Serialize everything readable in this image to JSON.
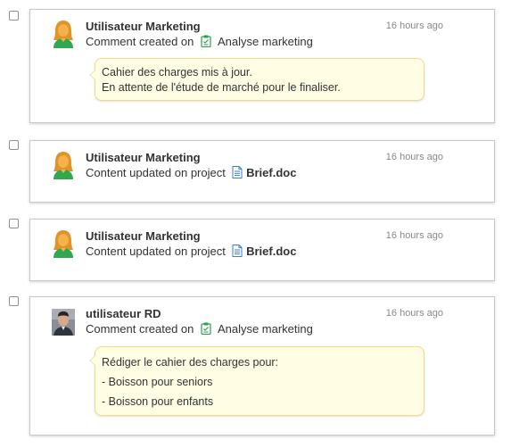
{
  "feed": {
    "items": [
      {
        "author": "Utilisateur Marketing",
        "time": "16 hours ago",
        "action": "Comment created on",
        "target": "Analyse marketing",
        "avatar": "female-user-avatar",
        "target_icon": "clipboard-icon",
        "comment_lines": [
          "Cahier des charges mis à jour.",
          "En attente de l'étude de marché pour le finaliser."
        ]
      },
      {
        "author": "Utilisateur Marketing",
        "time": "16 hours ago",
        "action": "Content updated on project",
        "target": "Brief.doc",
        "avatar": "female-user-avatar",
        "target_icon": "document-icon"
      },
      {
        "author": "Utilisateur Marketing",
        "time": "16 hours ago",
        "action": "Content updated on project",
        "target": "Brief.doc",
        "avatar": "female-user-avatar",
        "target_icon": "document-icon"
      },
      {
        "author": "utilisateur RD",
        "time": "16 hours ago",
        "action": "Comment created on",
        "target": "Analyse marketing",
        "avatar": "male-user-photo",
        "target_icon": "clipboard-icon",
        "comment_lines": [
          "Rédiger le cahier des charges pour:",
          "- Boisson pour seniors",
          "- Boisson pour enfants"
        ]
      }
    ]
  },
  "colors": {
    "bubble_bg": "#fffde4",
    "bubble_border": "#eedc8a",
    "clipboard_green": "#2e9e4f",
    "doc_blue": "#3b7dd8",
    "avatar_skin": "#f2a33a",
    "avatar_shirt": "#2fa84f"
  }
}
